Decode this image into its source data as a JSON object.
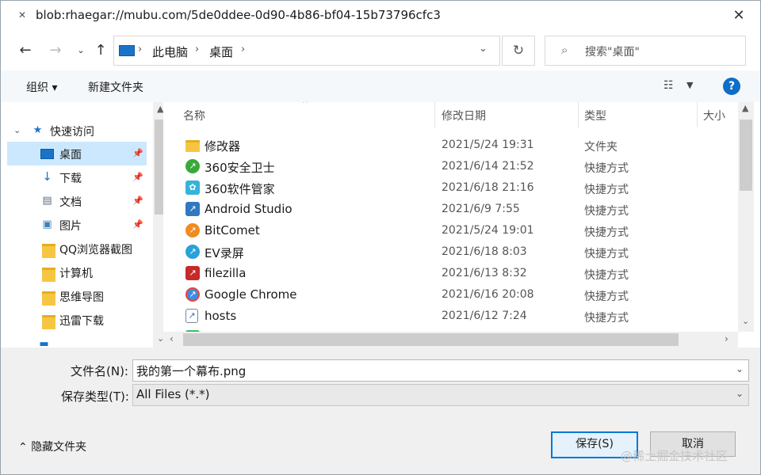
{
  "title": "blob:rhaegar://mubu.com/5de0ddee-0d90-4b86-bf04-15b73796cfc3",
  "address": [
    "此电脑",
    "桌面"
  ],
  "search_placeholder": "搜索\"桌面\"",
  "toolbar": {
    "organize": "组织",
    "new_folder": "新建文件夹",
    "help": "?"
  },
  "sidebar": {
    "quick_access": "快速访问",
    "items": [
      {
        "label": "桌面",
        "pinned": true,
        "selected": true
      },
      {
        "label": "下载",
        "pinned": true
      },
      {
        "label": "文档",
        "pinned": true
      },
      {
        "label": "图片",
        "pinned": true
      },
      {
        "label": "QQ浏览器截图"
      },
      {
        "label": "计算机"
      },
      {
        "label": "思维导图"
      },
      {
        "label": "迅雷下载"
      }
    ]
  },
  "columns": {
    "name": "名称",
    "date": "修改日期",
    "type": "类型",
    "size": "大小"
  },
  "files": [
    {
      "name": "修改器",
      "date": "2021/5/24 19:31",
      "type": "文件夹",
      "icon": "folder-icon",
      "color": "#f6c643"
    },
    {
      "name": "360安全卫士",
      "date": "2021/6/14 21:52",
      "type": "快捷方式",
      "icon": "360-safe-icon",
      "color": "#3aa93a"
    },
    {
      "name": "360软件管家",
      "date": "2021/6/18 21:16",
      "type": "快捷方式",
      "icon": "360-software-icon",
      "color": "#36b3d9"
    },
    {
      "name": "Android Studio",
      "date": "2021/6/9 7:55",
      "type": "快捷方式",
      "icon": "android-studio-icon",
      "color": "#2f78c2"
    },
    {
      "name": "BitComet",
      "date": "2021/5/24 19:01",
      "type": "快捷方式",
      "icon": "bitcomet-icon",
      "color": "#f28a1f"
    },
    {
      "name": "EV录屏",
      "date": "2021/6/18 8:03",
      "type": "快捷方式",
      "icon": "ev-recorder-icon",
      "color": "#2aa1d9"
    },
    {
      "name": "filezilla",
      "date": "2021/6/13 8:32",
      "type": "快捷方式",
      "icon": "filezilla-icon",
      "color": "#c72a2a"
    },
    {
      "name": "Google Chrome",
      "date": "2021/6/16 20:08",
      "type": "快捷方式",
      "icon": "chrome-icon",
      "color": "#3c8ce8"
    },
    {
      "name": "hosts",
      "date": "2021/6/12 7:24",
      "type": "快捷方式",
      "icon": "file-icon",
      "color": "#7a8794"
    }
  ],
  "form": {
    "filename_label": "文件名(N):",
    "filename_value": "我的第一个幕布.png",
    "filetype_label": "保存类型(T):",
    "filetype_value": "All Files (*.*)"
  },
  "hide_folders": "隐藏文件夹",
  "buttons": {
    "save": "保存(S)",
    "cancel": "取消"
  },
  "watermark": "@稀土掘金技术社区"
}
